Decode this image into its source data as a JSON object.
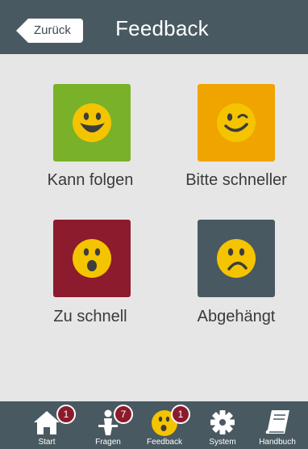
{
  "header": {
    "back_label": "Zurück",
    "title": "Feedback"
  },
  "options": [
    {
      "label": "Kann folgen",
      "color": "#79b229",
      "icon": "happy-face-icon"
    },
    {
      "label": "Bitte schneller",
      "color": "#f0a400",
      "icon": "winking-face-icon"
    },
    {
      "label": "Zu schnell",
      "color": "#8c1b2d",
      "icon": "surprised-face-icon"
    },
    {
      "label": "Abgehängt",
      "color": "#495961",
      "icon": "sad-face-icon"
    }
  ],
  "tabbar": {
    "items": [
      {
        "label": "Start",
        "badge": "1",
        "icon": "home-icon"
      },
      {
        "label": "Fragen",
        "badge": "7",
        "icon": "presenter-icon"
      },
      {
        "label": "Feedback",
        "badge": "1",
        "icon": "feedback-face-icon",
        "active": true
      },
      {
        "label": "System",
        "icon": "gear-icon"
      },
      {
        "label": "Handbuch",
        "icon": "book-icon"
      }
    ]
  },
  "colors": {
    "header_bg": "#495961",
    "page_bg": "#e6e6e6",
    "face_yellow": "#f5c400",
    "badge_red": "#8b1b2c"
  }
}
